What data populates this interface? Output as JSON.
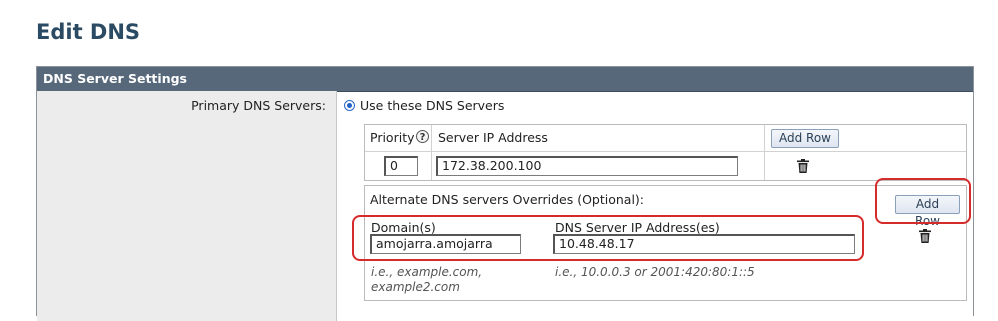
{
  "page": {
    "title": "Edit DNS"
  },
  "panel": {
    "header": "DNS Server Settings"
  },
  "primary_dns": {
    "label": "Primary DNS Servers:",
    "option_label": "Use these DNS Servers"
  },
  "servers_table": {
    "col_priority": "Priority",
    "col_server_ip": "Server IP Address",
    "add_row_label": "Add Row",
    "rows": [
      {
        "priority": "0",
        "server_ip": "172.38.200.100"
      }
    ]
  },
  "alternate": {
    "title": "Alternate DNS servers Overrides (Optional):",
    "add_row_label": "Add Row",
    "col_domains": "Domain(s)",
    "col_dns_ip": "DNS Server IP Address(es)",
    "domain_value": "amojarra.amojarra",
    "dns_ip_value": "10.48.48.17",
    "domain_hint": "i.e., example.com,\nexample2.com",
    "ip_hint": "i.e., 10.0.0.3 or 2001:420:80:1::5"
  },
  "colors": {
    "header_bg": "#56687a",
    "highlight": "#d62b2b",
    "title": "#2b4a63"
  }
}
